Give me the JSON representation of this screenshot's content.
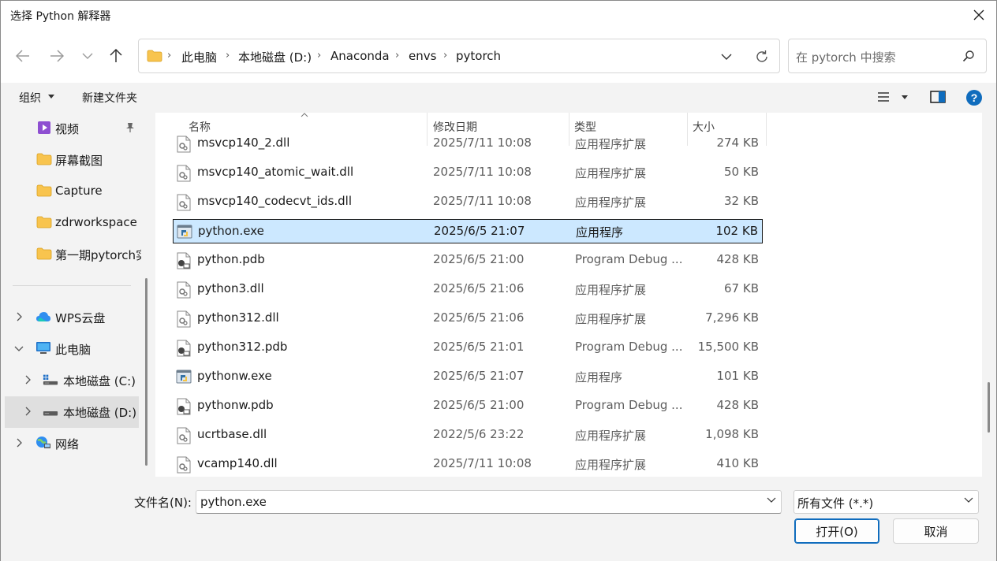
{
  "window": {
    "title": "选择 Python 解释器"
  },
  "address": {
    "crumbs": [
      "此电脑",
      "本地磁盘 (D:)",
      "Anaconda",
      "envs",
      "pytorch"
    ]
  },
  "search": {
    "placeholder": "在 pytorch 中搜索"
  },
  "toolbar": {
    "organize": "组织",
    "new_folder": "新建文件夹"
  },
  "sidebar": {
    "quick": [
      {
        "label": "视频",
        "icon": "video-icon",
        "pinned": true
      },
      {
        "label": "屏幕截图",
        "icon": "folder-icon"
      },
      {
        "label": "Capture",
        "icon": "folder-icon"
      },
      {
        "label": "zdrworkspace",
        "icon": "folder-icon"
      },
      {
        "label": "第一期pytorch实",
        "icon": "folder-icon"
      }
    ],
    "tree": [
      {
        "label": "WPS云盘",
        "icon": "cloud-icon",
        "expanded": false
      },
      {
        "label": "此电脑",
        "icon": "computer-icon",
        "expanded": true
      },
      {
        "label": "本地磁盘 (C:)",
        "icon": "drive-windows-icon",
        "expanded": false
      },
      {
        "label": "本地磁盘 (D:)",
        "icon": "drive-icon",
        "expanded": false,
        "selected": true
      },
      {
        "label": "网络",
        "icon": "network-icon",
        "expanded": false
      }
    ]
  },
  "columns": {
    "name": "名称",
    "date": "修改日期",
    "type": "类型",
    "size": "大小"
  },
  "files": [
    {
      "name": "msvcp140_2.dll",
      "date": "2025/7/11 10:08",
      "type": "应用程序扩展",
      "size": "274 KB",
      "icon": "dll-icon"
    },
    {
      "name": "msvcp140_atomic_wait.dll",
      "date": "2025/7/11 10:08",
      "type": "应用程序扩展",
      "size": "50 KB",
      "icon": "dll-icon"
    },
    {
      "name": "msvcp140_codecvt_ids.dll",
      "date": "2025/7/11 10:08",
      "type": "应用程序扩展",
      "size": "32 KB",
      "icon": "dll-icon"
    },
    {
      "name": "python.exe",
      "date": "2025/6/5 21:07",
      "type": "应用程序",
      "size": "102 KB",
      "icon": "python-exe-icon",
      "selected": true
    },
    {
      "name": "python.pdb",
      "date": "2025/6/5 21:00",
      "type": "Program Debug ...",
      "size": "428 KB",
      "icon": "pdb-icon"
    },
    {
      "name": "python3.dll",
      "date": "2025/6/5 21:06",
      "type": "应用程序扩展",
      "size": "67 KB",
      "icon": "dll-icon"
    },
    {
      "name": "python312.dll",
      "date": "2025/6/5 21:06",
      "type": "应用程序扩展",
      "size": "7,296 KB",
      "icon": "dll-icon"
    },
    {
      "name": "python312.pdb",
      "date": "2025/6/5 21:01",
      "type": "Program Debug ...",
      "size": "15,500 KB",
      "icon": "pdb-icon"
    },
    {
      "name": "pythonw.exe",
      "date": "2025/6/5 21:07",
      "type": "应用程序",
      "size": "101 KB",
      "icon": "python-exe-icon"
    },
    {
      "name": "pythonw.pdb",
      "date": "2025/6/5 21:00",
      "type": "Program Debug ...",
      "size": "428 KB",
      "icon": "pdb-icon"
    },
    {
      "name": "ucrtbase.dll",
      "date": "2022/5/6 23:22",
      "type": "应用程序扩展",
      "size": "1,098 KB",
      "icon": "dll-icon"
    },
    {
      "name": "vcamp140.dll",
      "date": "2025/7/11 10:08",
      "type": "应用程序扩展",
      "size": "410 KB",
      "icon": "dll-icon"
    }
  ],
  "bottom": {
    "filename_label": "文件名(N):",
    "filename_value": "python.exe",
    "filetype_value": "所有文件 (*.*)",
    "open_label": "打开(O)",
    "cancel_label": "取消"
  },
  "colors": {
    "accent": "#0f6cbd",
    "selection": "#cce8ff",
    "folder": "#f8c44e"
  }
}
